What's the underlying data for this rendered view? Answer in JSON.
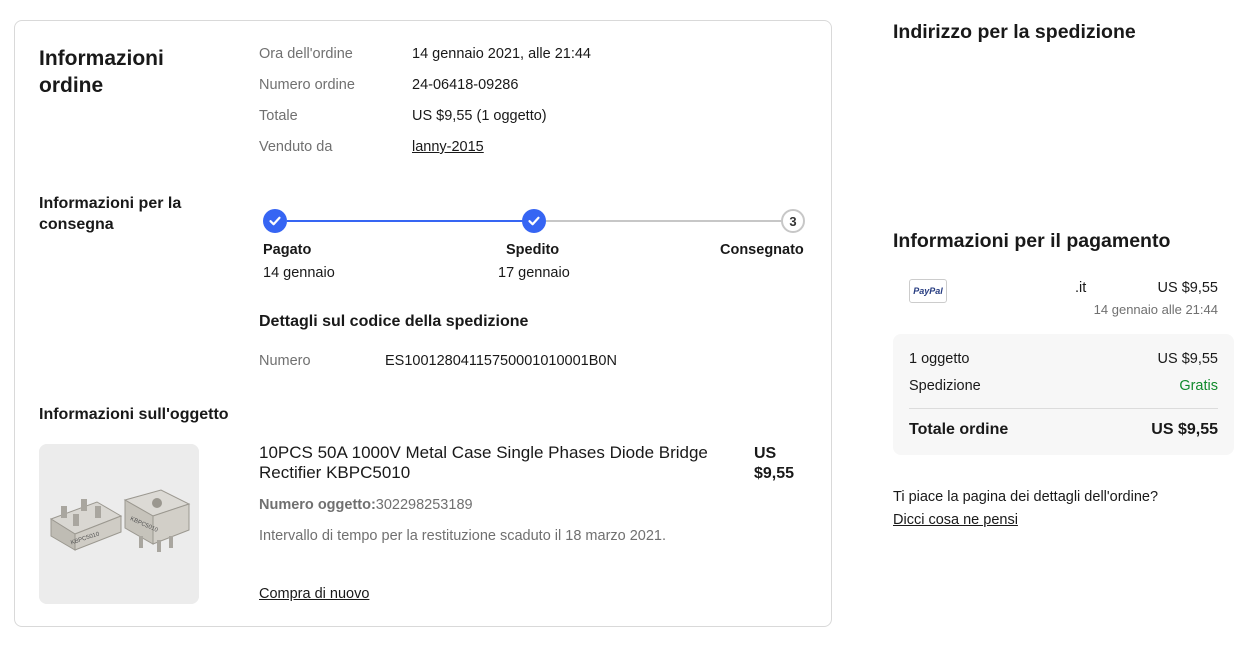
{
  "order_info": {
    "title": "Informazioni ordine",
    "rows": [
      {
        "label": "Ora dell'ordine",
        "value": "14 gennaio 2021, alle 21:44"
      },
      {
        "label": "Numero ordine",
        "value": "24-06418-09286"
      },
      {
        "label": "Totale",
        "value": "US $9,55 (1 oggetto)"
      },
      {
        "label": "Venduto da",
        "value": "lanny-2015"
      }
    ]
  },
  "delivery": {
    "title": "Informazioni per la consegna",
    "steps": [
      {
        "label": "Pagato",
        "date": "14 gennaio",
        "status": "done"
      },
      {
        "label": "Spedito",
        "date": "17 gennaio",
        "status": "done"
      },
      {
        "label": "Consegnato",
        "date": "",
        "status": "pending",
        "number": "3"
      }
    ],
    "tracking_title": "Dettagli sul codice della spedizione",
    "tracking_label": "Numero",
    "tracking_number": "ES10012804115750001010001B0N"
  },
  "item": {
    "section_title": "Informazioni sull'oggetto",
    "title": "10PCS 50A 1000V Metal Case Single Phases Diode Bridge Rectifier KBPC5010",
    "price_line1": "US",
    "price_line2": "$9,55",
    "number_label": "Numero oggetto:",
    "number_value": "302298253189",
    "return_note": "Intervallo di tempo per la restituzione scaduto il 18 marzo 2021.",
    "buy_again": "Compra di nuovo",
    "image_text_1": "KBPC5010",
    "image_text_2": "KBPC5010"
  },
  "shipping_address": {
    "title": "Indirizzo per la spedizione"
  },
  "payment": {
    "title": "Informazioni per il pagamento",
    "method_logo": "PayPal",
    "method_suffix": ".it",
    "amount": "US $9,55",
    "date": "14 gennaio alle 21:44",
    "summary": {
      "items_label": "1 oggetto",
      "items_value": "US $9,55",
      "shipping_label": "Spedizione",
      "shipping_value": "Gratis",
      "total_label": "Totale ordine",
      "total_value": "US $9,55"
    }
  },
  "feedback": {
    "question": "Ti piace la pagina dei dettagli dell'ordine?",
    "link": "Dicci cosa ne pensi"
  },
  "colors": {
    "accent": "#3665f3",
    "free_green": "#118a2c",
    "muted": "#707070"
  }
}
